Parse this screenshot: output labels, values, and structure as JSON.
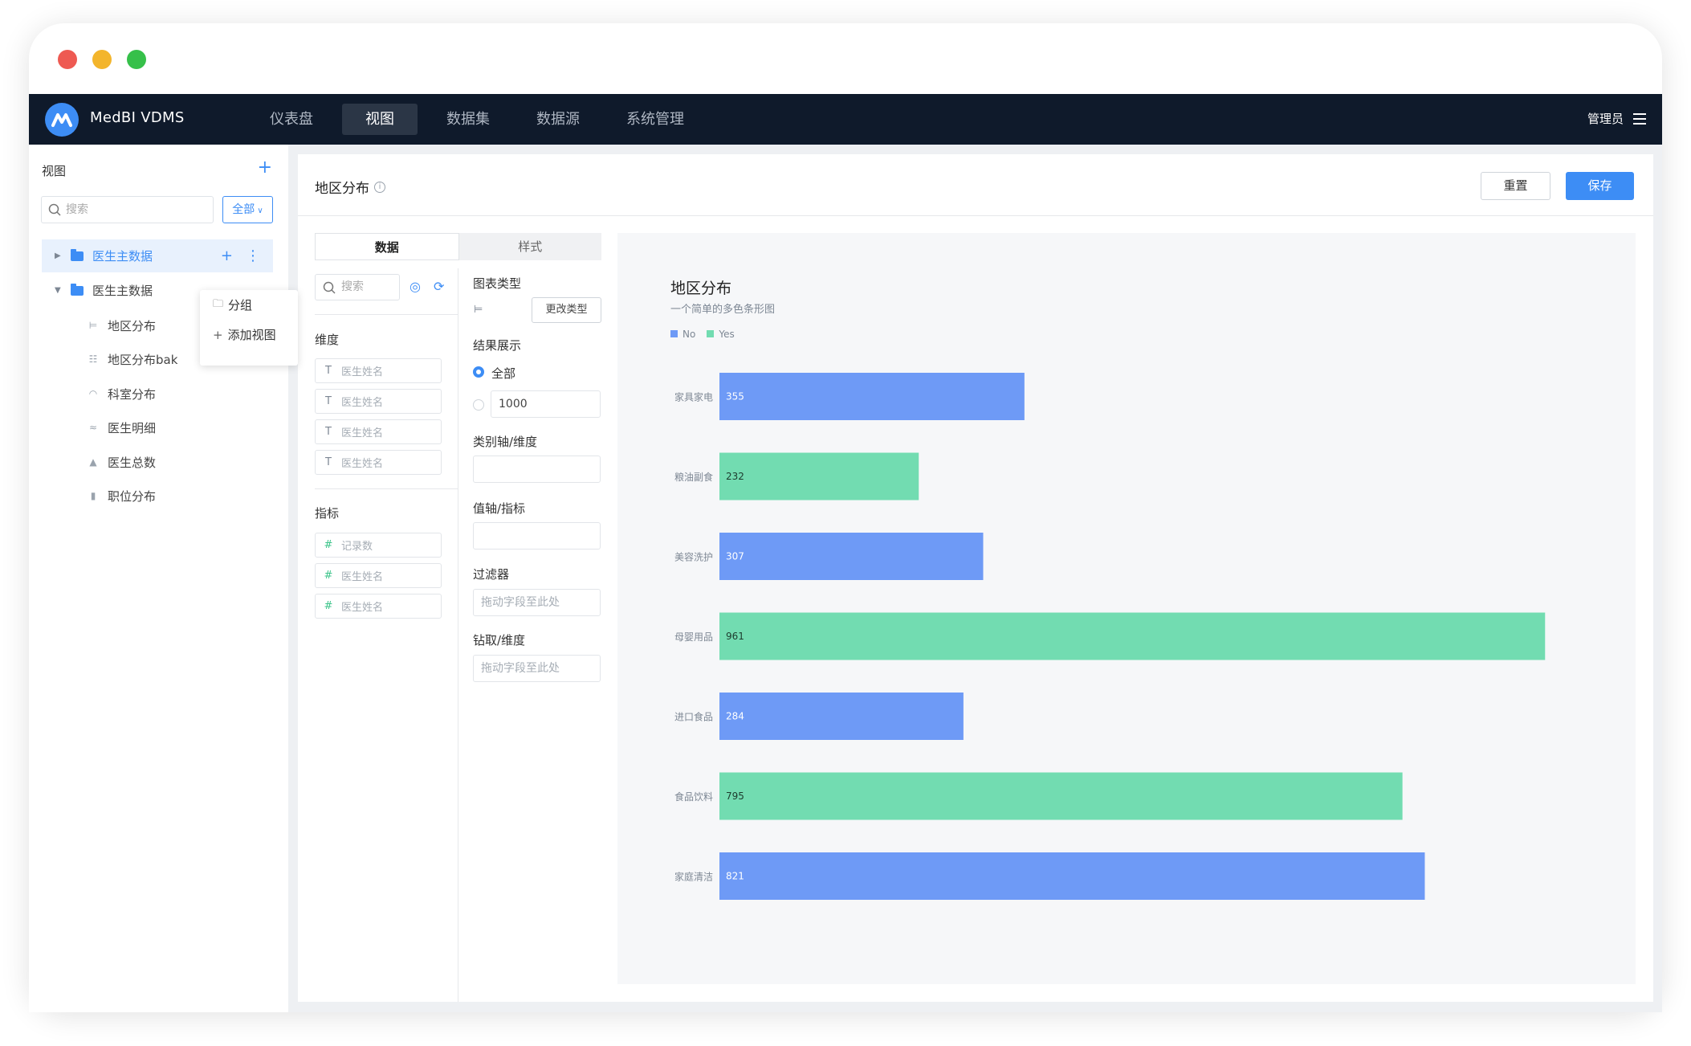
{
  "app": {
    "brand": "MedBI  VDMS",
    "nav": [
      "仪表盘",
      "视图",
      "数据集",
      "数据源",
      "系统管理"
    ],
    "nav_active": 1,
    "user": "管理员"
  },
  "sidebar": {
    "title": "视图",
    "search_placeholder": "搜索",
    "filter": "全部",
    "folders": [
      {
        "label": "医生主数据",
        "expanded": false,
        "selected": true
      },
      {
        "label": "医生主数据",
        "expanded": true,
        "selected": false
      }
    ],
    "items": [
      {
        "label": "地区分布",
        "icon": "bar-horizontal-icon"
      },
      {
        "label": "地区分布bak",
        "icon": "table-icon"
      },
      {
        "label": "科室分布",
        "icon": "gauge-icon"
      },
      {
        "label": "医生明细",
        "icon": "line-icon"
      },
      {
        "label": "医生总数",
        "icon": "area-icon"
      },
      {
        "label": "职位分布",
        "icon": "bar-vertical-icon"
      }
    ],
    "context_menu": [
      "分组",
      "添加视图"
    ]
  },
  "editor": {
    "title": "地区分布",
    "reset": "重置",
    "save": "保存",
    "tabs": [
      "数据",
      "样式"
    ],
    "search_placeholder": "搜索",
    "dimensions_label": "维度",
    "dimensions": [
      "医生姓名",
      "医生姓名",
      "医生姓名",
      "医生姓名"
    ],
    "metrics_label": "指标",
    "metrics": [
      "记录数",
      "医生姓名",
      "医生姓名"
    ],
    "chart_type_label": "图表类型",
    "change_type": "更改类型",
    "result_label": "结果展示",
    "result_all": "全部",
    "result_limit": "1000",
    "category_axis_label": "类别轴/维度",
    "value_axis_label": "值轴/指标",
    "filter_label": "过滤器",
    "filter_placeholder": "拖动字段至此处",
    "drill_label": "钻取/维度",
    "drill_placeholder": "拖动字段至此处"
  },
  "chart_data": {
    "type": "bar",
    "orientation": "horizontal",
    "title": "地区分布",
    "subtitle": "一个简单的多色条形图",
    "legend": [
      {
        "name": "No",
        "color": "#6e9af6"
      },
      {
        "name": "Yes",
        "color": "#72dcb1"
      }
    ],
    "categories": [
      "家具家电",
      "粮油副食",
      "美容洗护",
      "母婴用品",
      "进口食品",
      "食品饮料",
      "家庭清洁"
    ],
    "values": [
      355,
      232,
      307,
      961,
      284,
      795,
      821
    ],
    "bar_series": [
      "No",
      "Yes",
      "No",
      "Yes",
      "No",
      "Yes",
      "No"
    ],
    "xlim": [
      0,
      1000
    ],
    "grid": false
  }
}
